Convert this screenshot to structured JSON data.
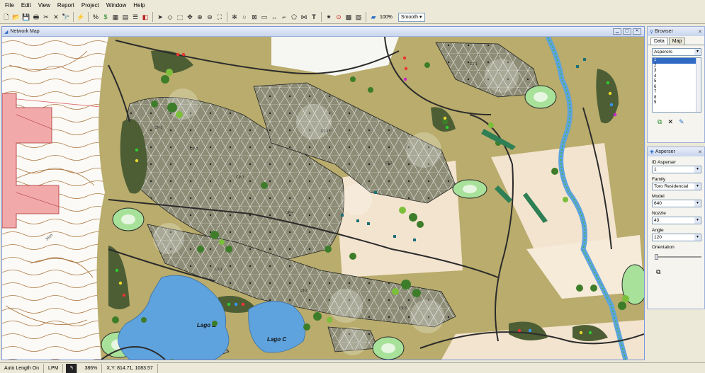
{
  "menubar": {
    "items": [
      "File",
      "Edit",
      "View",
      "Report",
      "Project",
      "Window",
      "Help"
    ]
  },
  "toolbar": {
    "zoom_label": "100%",
    "smooth_label": "Smooth"
  },
  "map_window": {
    "title": "Network Map",
    "labels": {
      "lake_b": "Lago B",
      "lake_c": "Lago C",
      "contour": "3010"
    }
  },
  "browser_panel": {
    "title": "Browser",
    "tabs": [
      "Data",
      "Map"
    ],
    "category": "Asperors",
    "items": [
      "1",
      "2",
      "3",
      "4",
      "5",
      "6",
      "7",
      "8",
      "9"
    ]
  },
  "asperser_panel": {
    "title": "Asperser",
    "fields": [
      {
        "label": "ID Asperser",
        "value": "1"
      },
      {
        "label": "Family",
        "value": "Toro Residencial"
      },
      {
        "label": "Model",
        "value": "640"
      },
      {
        "label": "Nozzle",
        "value": "43"
      },
      {
        "label": "Angle",
        "value": "120"
      }
    ],
    "orientation_label": "Orientation"
  },
  "statusbar": {
    "auto_length": "Auto Length On",
    "unit": "LPM",
    "zoom": "386%",
    "coords": "X,Y: 814.71, 1083.57"
  },
  "colors": {
    "rough": "#b9ac6c",
    "fairway": "#a6a18a",
    "sand": "#f3e4cf",
    "water": "#5ea3dd",
    "cart_path": "#2b2b2b",
    "tree": "#3d7d2a",
    "building": "#f2a9aa"
  }
}
